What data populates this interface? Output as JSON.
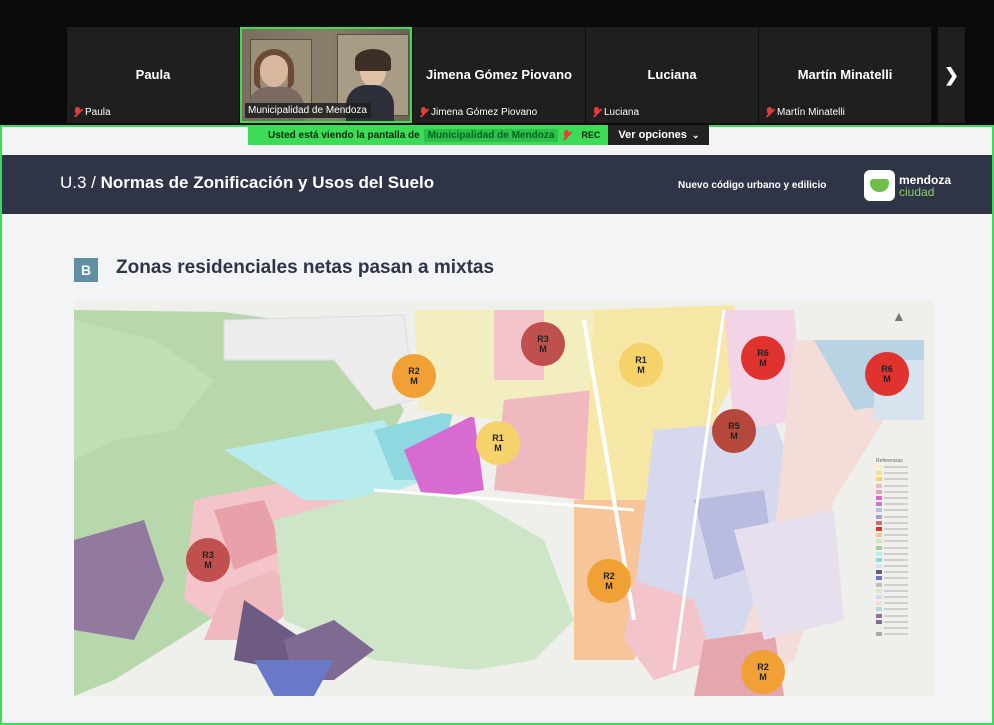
{
  "participants": [
    {
      "name": "Paula",
      "label": "Paula"
    },
    {
      "name": "",
      "label": "Municipalidad de Mendoza"
    },
    {
      "name": "Jimena Gómez Piovano",
      "label": "Jimena Gómez Piovano"
    },
    {
      "name": "Luciana",
      "label": "Luciana"
    },
    {
      "name": "Martín Minatelli",
      "label": "Martín Minatelli"
    }
  ],
  "next_icon": "chevron-right-icon",
  "share_bar": {
    "text": "Usted está viendo la pantalla de",
    "presenter": "Municipalidad de Mendoza",
    "rec": "REC",
    "options": "Ver opciones"
  },
  "slide": {
    "title_prefix": "U.3 / ",
    "title": "Normas de Zonificación y Usos del Suelo",
    "subtitle": "Nuevo código urbano y edilicio",
    "logo_line1": "mendoza",
    "logo_line2": "ciudad",
    "section_badge": "B",
    "heading": "Zonas residenciales netas pasan a mixtas"
  },
  "zones": [
    {
      "code": "R3",
      "sub": "M",
      "color": "#c0504d"
    },
    {
      "code": "R2",
      "sub": "M",
      "color": "#f0a035"
    },
    {
      "code": "R1",
      "sub": "M",
      "color": "#f5d36a"
    },
    {
      "code": "R6",
      "sub": "M",
      "color": "#e0322e"
    },
    {
      "code": "R6",
      "sub": "M",
      "color": "#e0322e"
    },
    {
      "code": "R1",
      "sub": "M",
      "color": "#f5d36a"
    },
    {
      "code": "R5",
      "sub": "M",
      "color": "#b5483a"
    },
    {
      "code": "R3",
      "sub": "M",
      "color": "#c0504d"
    },
    {
      "code": "R2",
      "sub": "M",
      "color": "#f0a035"
    },
    {
      "code": "R2",
      "sub": "M",
      "color": "#f0a035"
    }
  ],
  "legend_title": "Referencias",
  "colors": {
    "accent_green": "#3ddc57",
    "header_bg": "#2f3447"
  }
}
